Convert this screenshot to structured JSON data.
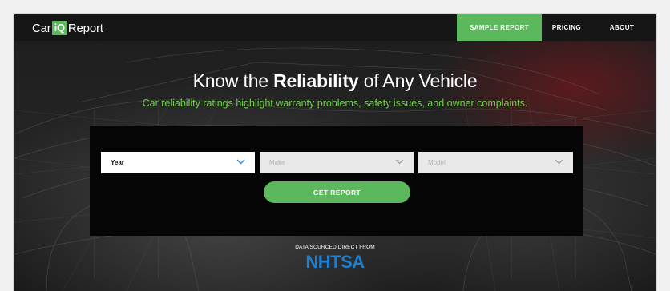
{
  "brand": {
    "prefix": "Car",
    "mark": "iQ",
    "suffix": "Report",
    "accent_color": "#5cb85c"
  },
  "nav": {
    "sample_report": "SAMPLE REPORT",
    "pricing": "PRICING",
    "about": "ABOUT"
  },
  "hero": {
    "title_before": "Know the ",
    "title_bold": "Reliability",
    "title_after": " of Any Vehicle",
    "subtitle": "Car reliability ratings highlight warranty problems, safety issues, and owner complaints.",
    "subtitle_color": "#6fcf4a"
  },
  "form": {
    "year": {
      "value": "Year"
    },
    "make": {
      "value": "Make"
    },
    "model": {
      "value": "Model"
    },
    "submit_label": "GET REPORT"
  },
  "source": {
    "label": "DATA SOURCED DIRECT FROM",
    "name": "NHTSA",
    "name_color": "#1e7fd0"
  },
  "icons": {
    "select_chevron": "chevron-down-icon"
  }
}
